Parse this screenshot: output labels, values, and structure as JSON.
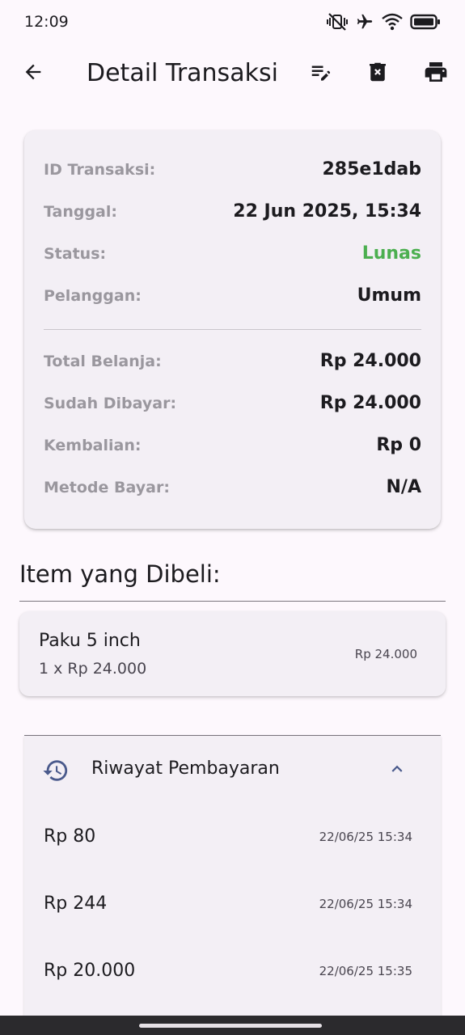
{
  "status_bar": {
    "time": "12:09",
    "icons": [
      "vibrate-off-icon",
      "airplane-icon",
      "wifi-icon",
      "battery-icon"
    ]
  },
  "app_bar": {
    "title": "Detail Transaksi",
    "actions": [
      "edit-notes-icon",
      "delete-icon",
      "print-icon"
    ]
  },
  "summary": {
    "id_label": "ID Transaksi:",
    "id_value": "285e1dab",
    "date_label": "Tanggal:",
    "date_value": "22 Jun 2025, 15:34",
    "status_label": "Status:",
    "status_value": "Lunas",
    "customer_label": "Pelanggan:",
    "customer_value": "Umum",
    "total_label": "Total Belanja:",
    "total_value": "Rp 24.000",
    "paid_label": "Sudah Dibayar:",
    "paid_value": "Rp 24.000",
    "change_label": "Kembalian:",
    "change_value": "Rp 0",
    "method_label": "Metode Bayar:",
    "method_value": "N/A"
  },
  "items_section": {
    "title": "Item yang Dibeli:",
    "items": [
      {
        "name": "Paku 5 inch",
        "qty_price": "1 x Rp 24.000",
        "total": "Rp 24.000"
      }
    ]
  },
  "payment_history": {
    "title": "Riwayat Pembayaran",
    "expanded": true,
    "entries": [
      {
        "amount": "Rp 80",
        "time": "22/06/25 15:34"
      },
      {
        "amount": "Rp 244",
        "time": "22/06/25 15:34"
      },
      {
        "amount": "Rp 20.000",
        "time": "22/06/25 15:35"
      }
    ]
  },
  "colors": {
    "background": "#fdf8fd",
    "card": "#f3eff5",
    "status_paid": "#4caf50",
    "accent": "#4a5a8c",
    "label_gray": "#9a979e"
  }
}
